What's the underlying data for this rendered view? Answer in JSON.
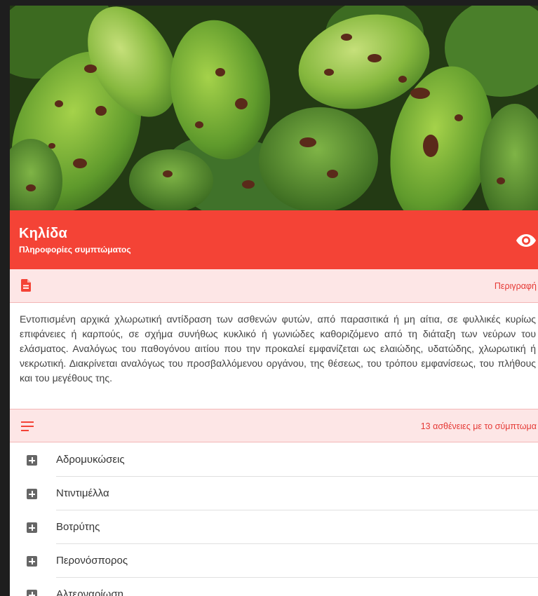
{
  "header": {
    "title": "Κηλίδα",
    "subtitle": "Πληροφορίες συμπτώματος",
    "view_icon": "eye-icon"
  },
  "description_section": {
    "icon": "document-icon",
    "label": "Περιγραφή",
    "text": "Εντοπισμένη αρχικά χλωρωτική αντίδραση των ασθενών φυτών, από παρασιτικά ή μη αίτια, σε φυλλικές κυρίως επιφάνειες ή καρπούς, σε σχήμα συνήθως κυκλικό ή γωνιώδες καθοριζόμενο από τη διάταξη των νεύρων του ελάσματος. Αναλόγως του παθογόνου αιτίου που την προκαλεί εμφανίζεται ως ελαιώδης, υδατώδης, χλωρωτική ή νεκρωτική. Διακρίνεται αναλόγως του προσβαλλόμενου οργάνου, της θέσεως, του τρόπου εμφανίσεως, του πλήθους και του μεγέθους της."
  },
  "list_section": {
    "icon": "list-icon",
    "label": "13 ασθένειες με το σύμπτωμα"
  },
  "diseases": [
    {
      "label": "Αδρομυκώσεις",
      "icon": "expand-plus-icon"
    },
    {
      "label": "Ντιντιμέλλα",
      "icon": "expand-plus-icon"
    },
    {
      "label": "Βοτρύτης",
      "icon": "expand-plus-icon"
    },
    {
      "label": "Περονόσπορος",
      "icon": "expand-plus-icon"
    },
    {
      "label": "Αλτερναρίωση",
      "icon": "expand-plus-icon"
    }
  ],
  "colors": {
    "accent": "#f44336",
    "section_bg": "#fde6e6",
    "accent_text": "#e53935"
  }
}
